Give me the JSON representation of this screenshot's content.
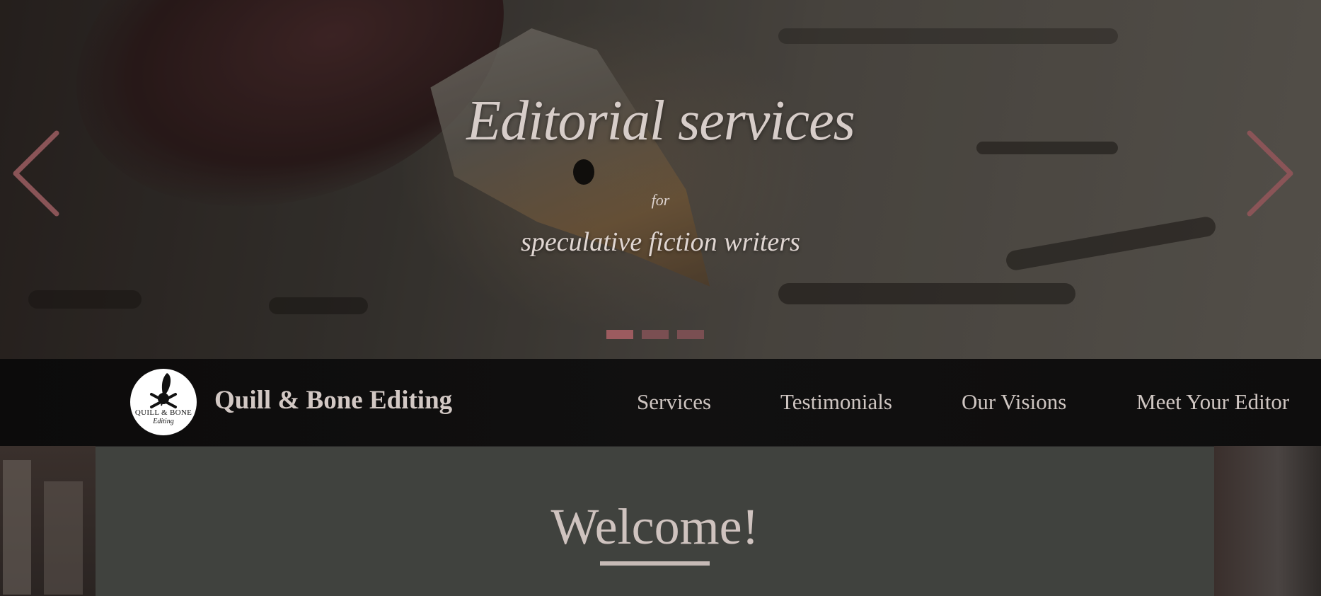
{
  "hero": {
    "title": "Editorial services",
    "connector": "for",
    "subtitle": "speculative fiction writers",
    "slide_count": 3,
    "active_slide": 1
  },
  "nav": {
    "logo": {
      "line1": "QUILL & BONE",
      "line2": "Editing"
    },
    "brand": "Quill & Bone Editing",
    "items": [
      {
        "label": "Services"
      },
      {
        "label": "Testimonials"
      },
      {
        "label": "Our Visions"
      },
      {
        "label": "Meet Your Editor"
      }
    ]
  },
  "content": {
    "heading": "Welcome!"
  },
  "colors": {
    "accent": "#9c5b5f",
    "nav_bg": "#0e0d0d",
    "card_bg": "#40423e",
    "text_light": "#d2c8c4"
  },
  "icons": {
    "prev": "chevron-left-icon",
    "next": "chevron-right-icon",
    "logo": "skull-quill-icon"
  }
}
